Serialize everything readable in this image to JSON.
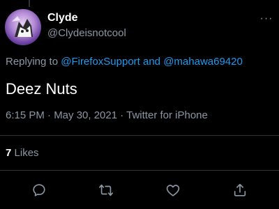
{
  "tweet": {
    "display_name": "Clyde",
    "handle": "@Clydeisnotcool",
    "replying_prefix": "Replying to",
    "reply_to_1": "@FirefoxSupport",
    "reply_conjunction": "and",
    "reply_to_2": "@mahawa69420",
    "text": "Deez Nuts",
    "timestamp": "6:15 PM · May 30, 2021 · Twitter for iPhone",
    "likes_count": "7",
    "likes_label": "Likes",
    "more_label": "···"
  },
  "actions": {
    "reply_icon": "reply-icon",
    "retweet_icon": "retweet-icon",
    "like_icon": "heart-icon",
    "share_icon": "share-icon"
  },
  "colors": {
    "background": "#000000",
    "primary_text": "#ffffff",
    "secondary_text": "#8b98a5",
    "accent": "#1d9bf0"
  }
}
